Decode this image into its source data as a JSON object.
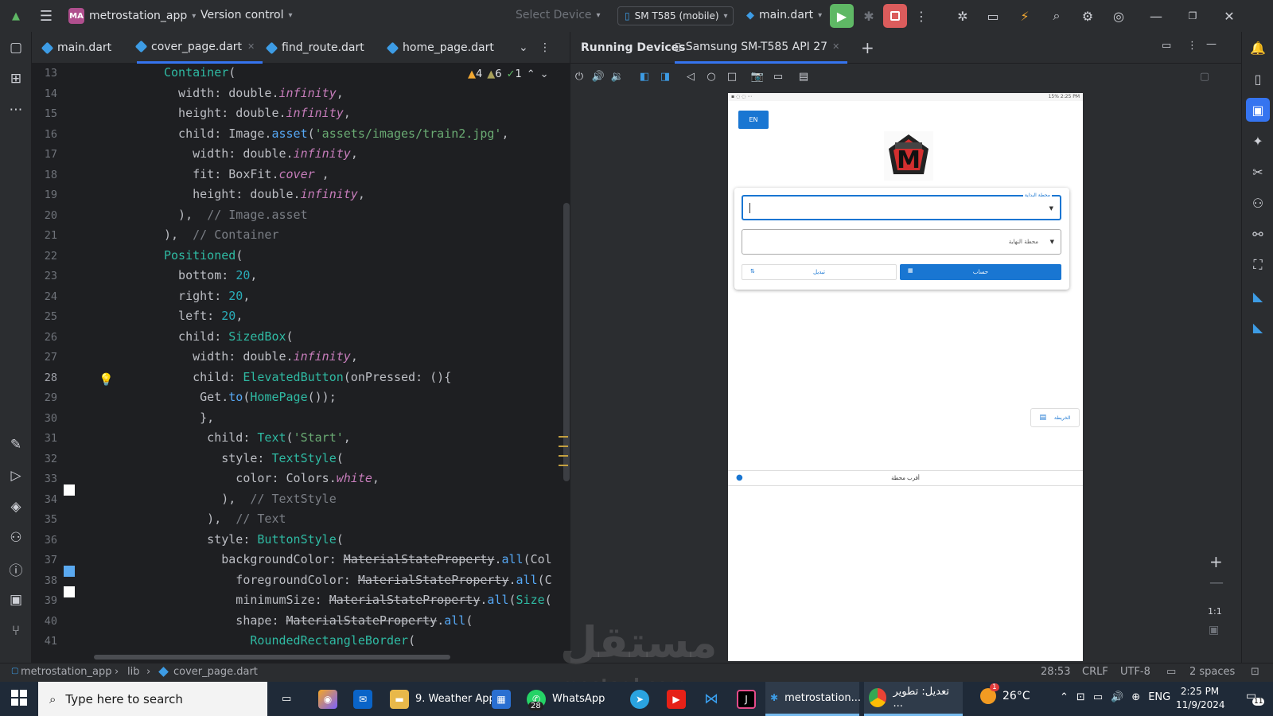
{
  "titlebar": {
    "project_badge": "MA",
    "project_name": "metrostation_app",
    "version_control": "Version control",
    "select_device": "Select Device",
    "device": "SM T585 (mobile)",
    "run_config": "main.dart"
  },
  "editor": {
    "tabs": [
      {
        "label": "main.dart"
      },
      {
        "label": "cover_page.dart"
      },
      {
        "label": "find_route.dart"
      },
      {
        "label": "home_page.dart"
      }
    ],
    "inspections": {
      "warnings": "4",
      "weak_warnings": "6",
      "ok": "1"
    },
    "line_numbers": [
      "13",
      "14",
      "15",
      "16",
      "17",
      "18",
      "19",
      "20",
      "21",
      "22",
      "23",
      "24",
      "25",
      "26",
      "27",
      "28",
      "29",
      "30",
      "31",
      "32",
      "33",
      "34",
      "35",
      "36",
      "37",
      "38",
      "39",
      "40",
      "41"
    ],
    "code_lines": [
      "Container(",
      "  width: double.infinity,",
      "  height: double.infinity,",
      "  child: Image.asset('assets/images/train2.jpg',",
      "    width: double.infinity,",
      "    fit: BoxFit.cover ,",
      "    height: double.infinity,",
      "  ),  // Image.asset",
      "),  // Container",
      "Positioned(",
      "  bottom: 20,",
      "  right: 20,",
      "  left: 20,",
      "  child: SizedBox(",
      "    width: double.infinity,",
      "    child: ElevatedButton(onPressed: (){",
      "     Get.to(HomePage());",
      "     },",
      "      child: Text('Start',",
      "        style: TextStyle(",
      "          color: Colors.white,",
      "        ),  // TextStyle",
      "      ),  // Text",
      "      style: ButtonStyle(",
      "        backgroundColor: MaterialStateProperty.all(Col",
      "          foregroundColor: MaterialStateProperty.all(C",
      "          minimumSize: MaterialStateProperty.all(Size(",
      "          shape: MaterialStateProperty.all(",
      "            RoundedRectangleBorder("
    ]
  },
  "running_devices": {
    "title": "Running Devices",
    "device_tab": "Samsung SM-T585 API 27"
  },
  "phone": {
    "status_right": "15% 2:25 PM",
    "lang_button": "EN",
    "start_station_label": "محطة البداية",
    "end_station_hint": "محطة النهاية",
    "swap_button": "تبديل",
    "calculate_button": "حساب",
    "map_button": "الخريطة",
    "nearest_station": "أقرب محطة"
  },
  "zoom": {
    "actual_size": "1:1"
  },
  "statusbar": {
    "breadcrumb": [
      "metrostation_app",
      "lib",
      "cover_page.dart"
    ],
    "position": "28:53",
    "line_sep": "CRLF",
    "encoding": "UTF-8",
    "indent": "2 spaces"
  },
  "watermark": {
    "text": "مستقل",
    "sub": "mostaql.com"
  },
  "taskbar": {
    "search_placeholder": "Type here to search",
    "apps": [
      {
        "label": "9. Weather App"
      },
      {
        "label": "WhatsApp",
        "badge": "28"
      },
      {
        "label": "metrostation..."
      },
      {
        "label": "تعديل: تطوير ..."
      }
    ],
    "weather": "26°C",
    "weather_badge": "1",
    "lang": "ENG",
    "time": "2:25 PM",
    "date": "11/9/2024",
    "notifications": "11"
  },
  "colors": {
    "accent": "#3574f0",
    "run_green": "#5fb865",
    "stop_red": "#db5c5c",
    "phone_primary": "#1976d2"
  }
}
